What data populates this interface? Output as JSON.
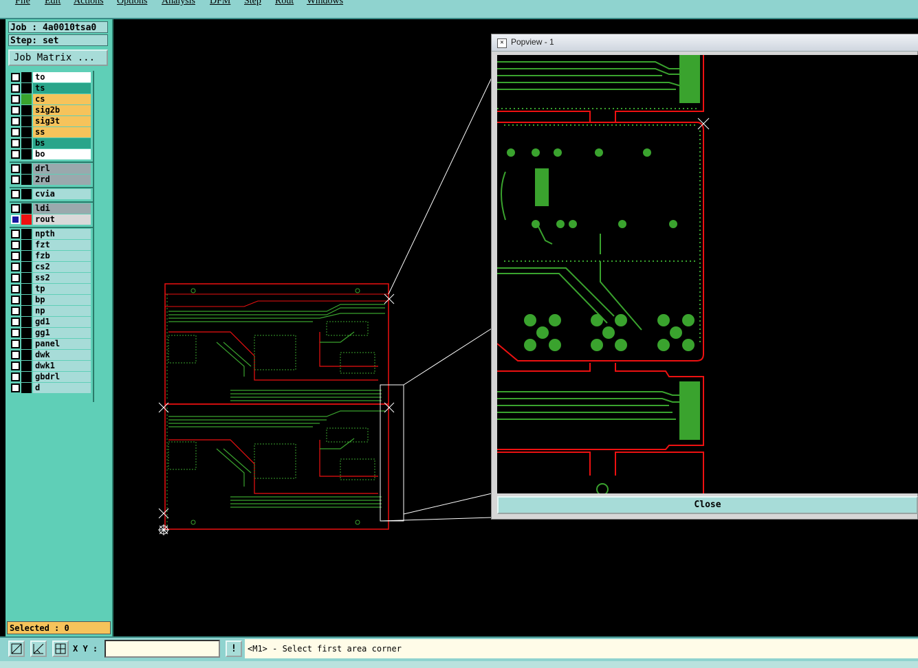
{
  "menu": [
    "File",
    "Edit",
    "Actions",
    "Options",
    "Analysis",
    "DFM",
    "Step",
    "Rout",
    "Windows"
  ],
  "job_label": "Job : 4a0010tsa0",
  "step_label": "Step: set",
  "job_matrix_button": "Job Matrix ...",
  "layers": [
    {
      "name": "to",
      "bg": "#ffffff",
      "swatch": "#000000"
    },
    {
      "name": "ts",
      "bg": "#2aa58a",
      "swatch": "#000000"
    },
    {
      "name": "cs",
      "bg": "#f6c35b",
      "swatch": "#3aa32e"
    },
    {
      "name": "sig2b",
      "bg": "#f6c35b",
      "swatch": "#000000"
    },
    {
      "name": "sig3t",
      "bg": "#f6c35b",
      "swatch": "#000000"
    },
    {
      "name": "ss",
      "bg": "#f6c35b",
      "swatch": "#000000"
    },
    {
      "name": "bs",
      "bg": "#2aa58a",
      "swatch": "#000000"
    },
    {
      "name": "bo",
      "bg": "#ffffff",
      "swatch": "#000000"
    },
    {
      "name": "drl",
      "bg": "#9aa9ad",
      "swatch": "#000000"
    },
    {
      "name": "2rd",
      "bg": "#9aa9ad",
      "swatch": "#000000"
    },
    {
      "name": "cvia",
      "bg": "#a7dcd8",
      "swatch": "#000000"
    },
    {
      "name": "ldi",
      "bg": "#9aa9ad",
      "swatch": "#000000"
    },
    {
      "name": "rout",
      "bg": "#d9d9d9",
      "swatch": "#ee1111"
    },
    {
      "name": "npth",
      "bg": "#a7dcd8",
      "swatch": "#000000"
    },
    {
      "name": "fzt",
      "bg": "#a7dcd8",
      "swatch": "#000000"
    },
    {
      "name": "fzb",
      "bg": "#a7dcd8",
      "swatch": "#000000"
    },
    {
      "name": "cs2",
      "bg": "#a7dcd8",
      "swatch": "#000000"
    },
    {
      "name": "ss2",
      "bg": "#a7dcd8",
      "swatch": "#000000"
    },
    {
      "name": "tp",
      "bg": "#a7dcd8",
      "swatch": "#000000"
    },
    {
      "name": "bp",
      "bg": "#a7dcd8",
      "swatch": "#000000"
    },
    {
      "name": "np",
      "bg": "#a7dcd8",
      "swatch": "#000000"
    },
    {
      "name": "gd1",
      "bg": "#a7dcd8",
      "swatch": "#000000"
    },
    {
      "name": "gg1",
      "bg": "#a7dcd8",
      "swatch": "#000000"
    },
    {
      "name": "panel",
      "bg": "#a7dcd8",
      "swatch": "#000000"
    },
    {
      "name": "dwk",
      "bg": "#a7dcd8",
      "swatch": "#000000"
    },
    {
      "name": "dwk1",
      "bg": "#a7dcd8",
      "swatch": "#000000"
    },
    {
      "name": "gbdrl",
      "bg": "#a7dcd8",
      "swatch": "#000000"
    },
    {
      "name": "d",
      "bg": "#a7dcd8",
      "swatch": "#000000"
    }
  ],
  "selected_label": "Selected : 0",
  "xy_label": "X Y :",
  "xy_value": "",
  "status_message": "<M1> - Select first area corner",
  "popview": {
    "title": "Popview - 1",
    "close_label": "Close"
  },
  "colors": {
    "trace": "#3aa32e",
    "outline": "#ee1111",
    "background": "#000000",
    "panel": "#5fcfb7"
  }
}
